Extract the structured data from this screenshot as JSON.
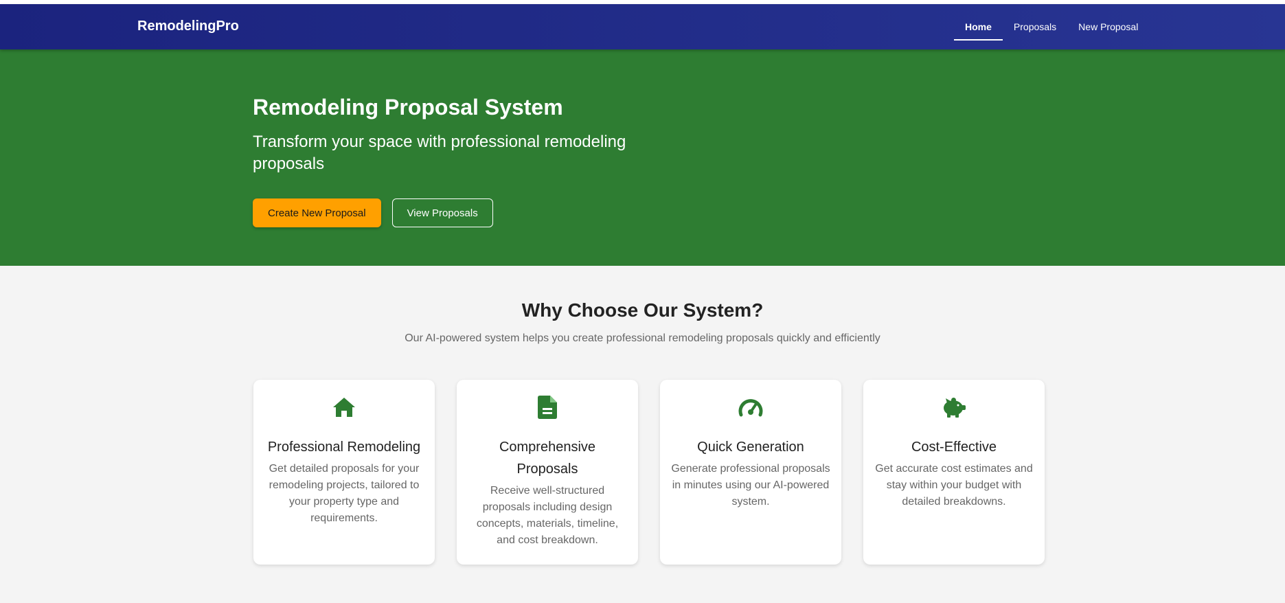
{
  "brand": "RemodelingPro",
  "nav": {
    "home": "Home",
    "proposals": "Proposals",
    "new_proposal": "New Proposal"
  },
  "hero": {
    "title": "Remodeling Proposal System",
    "subtitle": "Transform your space with professional remodeling proposals",
    "primary_button": "Create New Proposal",
    "secondary_button": "View Proposals"
  },
  "features": {
    "title": "Why Choose Our System?",
    "subtitle": "Our AI-powered system helps you create professional remodeling proposals quickly and efficiently",
    "cards": [
      {
        "icon": "home-icon",
        "title": "Professional Remodeling",
        "text": "Get detailed proposals for your remodeling projects, tailored to your property type and requirements."
      },
      {
        "icon": "document-icon",
        "title": "Comprehensive Proposals",
        "text": "Receive well-structured proposals including design concepts, materials, timeline, and cost breakdown."
      },
      {
        "icon": "speedometer-icon",
        "title": "Quick Generation",
        "text": "Generate professional proposals in minutes using our AI-powered system."
      },
      {
        "icon": "piggy-bank-icon",
        "title": "Cost-Effective",
        "text": "Get accurate cost estimates and stay within your budget with detailed breakdowns."
      }
    ]
  },
  "colors": {
    "navbar": "#1b237e",
    "hero": "#2e7d32",
    "accent": "#ffa000",
    "icon": "#2e7d32"
  }
}
